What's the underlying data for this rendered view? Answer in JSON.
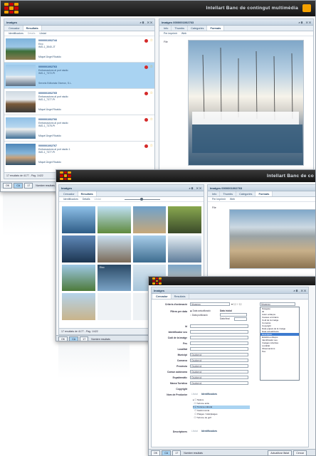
{
  "app_title": "Intellart Banc de contingut multimèdia",
  "win1": {
    "left_panel": {
      "title": "Imatges",
      "tools": "⌕ ⊟ _ ✕ ✕",
      "tabs": [
        "Cercador",
        "Resultats"
      ],
      "subtabs": [
        "Identificadors",
        "Detalls",
        "Llistat"
      ],
      "rows": [
        {
          "id": "0000001002744",
          "desc": "Eixo",
          "code": "IMG-1_3540-JT",
          "author": "Miquel Àngel Ricaldo"
        },
        {
          "id": "0000001002763",
          "desc": "Embarcacions al port náutic",
          "code": "IMG-1_7372-Pt",
          "author": "Serveis Editorials Giveron, S.L."
        },
        {
          "id": "0000001002765",
          "desc": "Embarcacions al port náutic",
          "code": "IMG-1_7377-Pt",
          "author": "Miquel Àngel Ricaldo"
        },
        {
          "id": "0000001002766",
          "desc": "Embarcacions al port náutic",
          "code": "IMG-1_7375-Pt",
          "author": "Miquel Àngel Ricaldo"
        },
        {
          "id": "0000001002767",
          "desc": "Embarcacions al port náutic 1",
          "code": "IMG-1_7377-Pt",
          "author": "Miquel Àngel Ricaldo"
        }
      ],
      "pager": "17 resultats de 4177 - Pàg. 1/422",
      "next_label": "Next"
    },
    "right_panel": {
      "title": "Imatges 0000001002763",
      "tools": "⌕ ⊟ _ ✕ ✕",
      "tabs": [
        "Info",
        "Thumbs",
        "Categories",
        "Formats"
      ],
      "subtabs": [
        "Per imprimir",
        "Web"
      ],
      "file_label": "File",
      "footer_label": "Tipo Medio",
      "footer_value": "Imágenes"
    },
    "bottombar": {
      "btn1": "OK",
      "btn2": "CA",
      "btn3": "17",
      "text": "Nombre resultats"
    }
  },
  "win2": {
    "app_title": "Intellart Banc de co",
    "left_panel": {
      "title": "Imatges",
      "tools": "⌕ ⊟ _ ✕ ✕",
      "tabs": [
        "Cercador",
        "Resultats"
      ],
      "subtabs": [
        "Identificadors",
        "Detalls",
        "Llistat"
      ],
      "caption": "Eixo",
      "pager": "17 resultats de 4177 - Pàg. 1/422"
    },
    "right_panel": {
      "title": "Imatges 0000001002763",
      "tabs": [
        "Info",
        "Thumbs",
        "Categories",
        "Formats"
      ],
      "subtabs": [
        "Per imprimir",
        "Web"
      ],
      "file_label": "File"
    },
    "bottombar": {
      "btn1": "OK",
      "btn2": "CA",
      "btn3": "17",
      "text": "Nombre resultats"
    }
  },
  "win3": {
    "panel_title": "Imatges",
    "tools": "⌕ ⊟ _ ✕ ✕",
    "tabs": [
      "Cercador",
      "Resultats"
    ],
    "form": {
      "criterio_label": "Criteris d'ordenació",
      "criterio_value": "Nisagrau",
      "criterio_value2": "Nisagrau",
      "filtres_label": "Filtres per data",
      "data_actualitzacio": "Data actualització",
      "data_publicacio": "Data publicació",
      "data_inicial": "Data inicial",
      "data_final": "Data final",
      "id_label": "Id",
      "identificador_label": "Identificador seu",
      "codi_label": "Codi de la imatge",
      "pes_label": "Pes",
      "localitat_label": "Localitat",
      "municipi_label": "Municipi",
      "municipi_value": "Qualsevol",
      "comarca_label": "Comarca",
      "comarca_value": "Qualsevol",
      "provincia_label": "Província",
      "provincia_value": "Qualsevol",
      "comunitat_label": "Comun autònoma",
      "comunitat_value": "Qualsevol",
      "espai_label": "Espaitemàtic",
      "espai_value": "Qualsevol",
      "marca_label": "Marca Turística",
      "marca_value": "Qualsevol",
      "copyright_label": "Copyright",
      "nom_label": "Nom de Productor",
      "nom_tabs": [
        "Llistat",
        "Identificadors"
      ],
      "descriptores_label": "Descriptores",
      "desc_tabs": [
        "Llistat",
        "Identificadors"
      ]
    },
    "dropdown": [
      "Nisagrau",
      "ID",
      "Autor enllaços",
      "Causes a fotrains",
      "Codi de la imatge",
      "Comarca",
      "Copyright",
      "Data pujava de la imatge",
      "Data actualització",
      "Descripció",
      "Estàtica enllaços",
      "Identificador seu",
      "Imatges referides",
      "Localitat",
      "Observacions",
      "Pes"
    ],
    "dropdown_highlight": 9,
    "tree": [
      "Natura",
      "Turisme actiu",
      "Turisme cultural",
      "Gastronomia",
      "Platges i Vals/platges",
      "Turisme de golf"
    ],
    "tree_highlight": 2,
    "bottombar": {
      "btn1": "OK",
      "btn2": "CA",
      "btn3": "17",
      "text": "Nombre resultats",
      "actualitzar": "Actualitzar llistat",
      "cercar": "Cercar"
    }
  }
}
